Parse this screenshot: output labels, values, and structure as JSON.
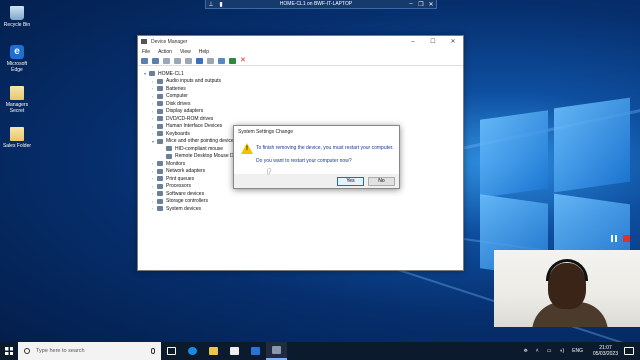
{
  "rdp_bar": {
    "title": "HOME-CL1 on BWF-IT-LAPTOP"
  },
  "desktop_icons": [
    {
      "label": "Recycle Bin",
      "icon": "recycle-bin-icon"
    },
    {
      "label": "Microsoft Edge",
      "icon": "edge-icon"
    },
    {
      "label": "Managers Secret",
      "icon": "file-icon"
    },
    {
      "label": "Sales Folder",
      "icon": "file-icon"
    }
  ],
  "device_manager": {
    "title": "Device Manager",
    "menu": [
      "File",
      "Action",
      "View",
      "Help"
    ],
    "root": "HOME-CL1",
    "categories": [
      "Audio inputs and outputs",
      "Batteries",
      "Computer",
      "Disk drives",
      "Display adapters",
      "DVD/CD-ROM drives",
      "Human Interface Devices",
      "Keyboards",
      "Mice and other pointing devices",
      "Monitors",
      "Network adapters",
      "Print queues",
      "Processors",
      "Software devices",
      "Storage controllers",
      "System devices"
    ],
    "mice_children": [
      "HID-compliant mouse",
      "Remote Desktop Mouse Device"
    ]
  },
  "dialog": {
    "title": "System Settings Change",
    "message": "To finish removing the device, you must restart your computer.",
    "question": "Do you want to restart your computer now?",
    "yes_label": "Yes",
    "no_label": "No"
  },
  "taskbar": {
    "search_placeholder": "Type here to search",
    "language": "ENG",
    "time": "21:07",
    "date": "05/03/2023"
  }
}
